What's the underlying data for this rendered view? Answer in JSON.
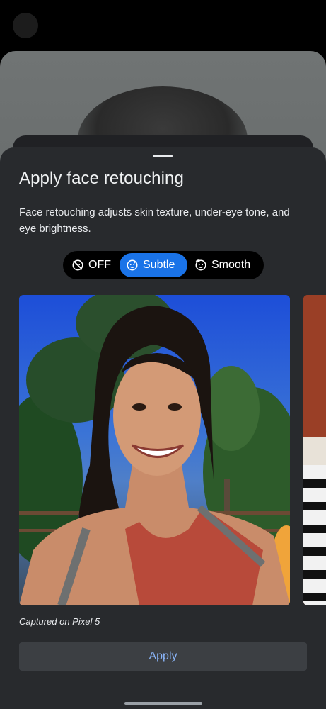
{
  "sheet": {
    "title": "Apply face retouching",
    "description": "Face retouching adjusts skin texture, under-eye tone, and eye brightness."
  },
  "retouch_options": {
    "selected": "Subtle",
    "items": [
      {
        "label": "OFF",
        "icon": "retouch-off-icon"
      },
      {
        "label": "Subtle",
        "icon": "face-subtle-icon"
      },
      {
        "label": "Smooth",
        "icon": "face-smooth-icon"
      }
    ]
  },
  "preview": {
    "caption": "Captured on Pixel 5"
  },
  "actions": {
    "apply_label": "Apply"
  },
  "colors": {
    "sheet_bg": "#282a2d",
    "accent": "#1a73e8",
    "apply_text": "#8ab4f8"
  }
}
